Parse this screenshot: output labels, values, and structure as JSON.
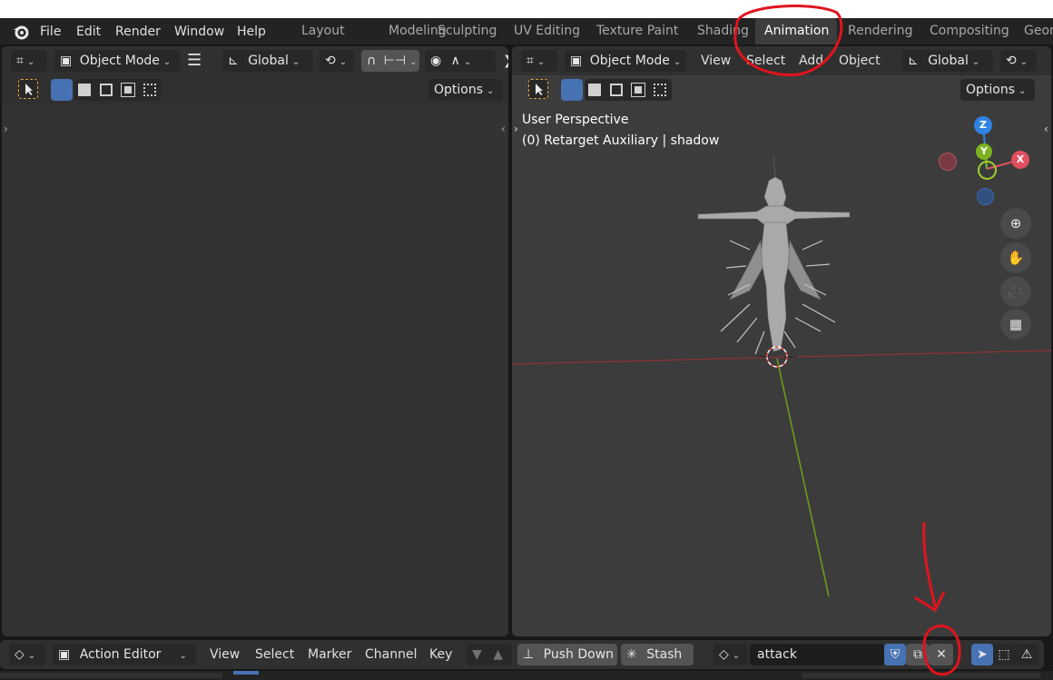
{
  "topbar": {
    "menus": [
      "File",
      "Edit",
      "Render",
      "Window",
      "Help"
    ],
    "workspaces": [
      "Layout",
      "Modeling",
      "Sculpting",
      "UV Editing",
      "Texture Paint",
      "Shading",
      "Animation",
      "Rendering",
      "Compositing",
      "Geon"
    ],
    "active_workspace": "Animation"
  },
  "left_editor": {
    "mode": "Object Mode",
    "orientation": "Global",
    "options": "Options"
  },
  "right_editor": {
    "mode": "Object Mode",
    "menus": [
      "View",
      "Select",
      "Add",
      "Object"
    ],
    "orientation": "Global",
    "options": "Options",
    "overlay": {
      "view_name": "User Perspective",
      "object_info": "(0) Retarget Auxiliary | shadow"
    },
    "gizmo": {
      "z": "Z",
      "y": "Y",
      "x": "X"
    }
  },
  "action_editor": {
    "editor_mode": "Action Editor",
    "menus": [
      "View",
      "Select",
      "Marker",
      "Channel",
      "Key"
    ],
    "push_down": "Push Down",
    "stash": "Stash",
    "action_name": "attack"
  },
  "colors": {
    "active_blue": "#4772b3",
    "annotation_red": "#e0141e",
    "x_axis": "#e0505f",
    "y_axis": "#7bb21f",
    "z_axis": "#2f83e3"
  }
}
